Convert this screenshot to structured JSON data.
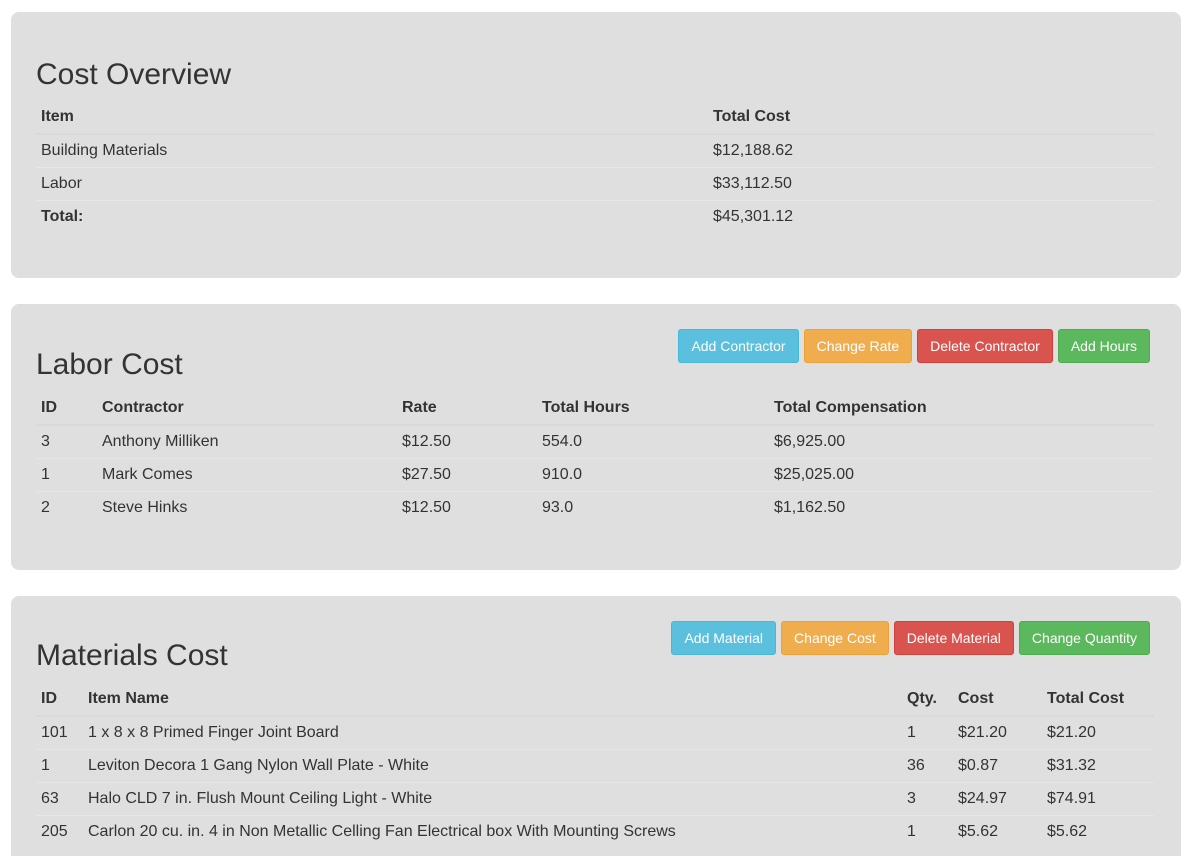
{
  "overview": {
    "title": "Cost Overview",
    "headers": [
      "Item",
      "Total Cost"
    ],
    "rows": [
      {
        "item": "Building Materials",
        "total": "$12,188.62"
      },
      {
        "item": "Labor",
        "total": "$33,112.50"
      },
      {
        "item": "Total:",
        "total": "$45,301.12"
      }
    ]
  },
  "labor": {
    "title": "Labor Cost",
    "buttons": {
      "add": "Add Contractor",
      "change": "Change Rate",
      "delete": "Delete Contractor",
      "hours": "Add Hours"
    },
    "headers": [
      "ID",
      "Contractor",
      "Rate",
      "Total Hours",
      "Total Compensation"
    ],
    "rows": [
      {
        "id": "3",
        "name": "Anthony Milliken",
        "rate": "$12.50",
        "hours": "554.0",
        "comp": "$6,925.00"
      },
      {
        "id": "1",
        "name": "Mark Comes",
        "rate": "$27.50",
        "hours": "910.0",
        "comp": "$25,025.00"
      },
      {
        "id": "2",
        "name": "Steve Hinks",
        "rate": "$12.50",
        "hours": "93.0",
        "comp": "$1,162.50"
      }
    ]
  },
  "materials": {
    "title": "Materials Cost",
    "buttons": {
      "add": "Add Material",
      "change": "Change Cost",
      "delete": "Delete Material",
      "quantity": "Change Quantity"
    },
    "headers": [
      "ID",
      "Item Name",
      "Qty.",
      "Cost",
      "Total Cost"
    ],
    "rows": [
      {
        "id": "101",
        "name": "1 x 8 x 8 Primed Finger Joint Board",
        "qty": "1",
        "cost": "$21.20",
        "total": "$21.20"
      },
      {
        "id": "1",
        "name": "Leviton Decora 1 Gang Nylon Wall Plate - White",
        "qty": "36",
        "cost": "$0.87",
        "total": "$31.32"
      },
      {
        "id": "63",
        "name": "Halo CLD 7 in. Flush Mount Ceiling Light - White",
        "qty": "3",
        "cost": "$24.97",
        "total": "$74.91"
      },
      {
        "id": "205",
        "name": "Carlon 20 cu. in. 4 in Non Metallic Celling Fan Electrical box With Mounting Screws",
        "qty": "1",
        "cost": "$5.62",
        "total": "$5.62"
      }
    ]
  }
}
